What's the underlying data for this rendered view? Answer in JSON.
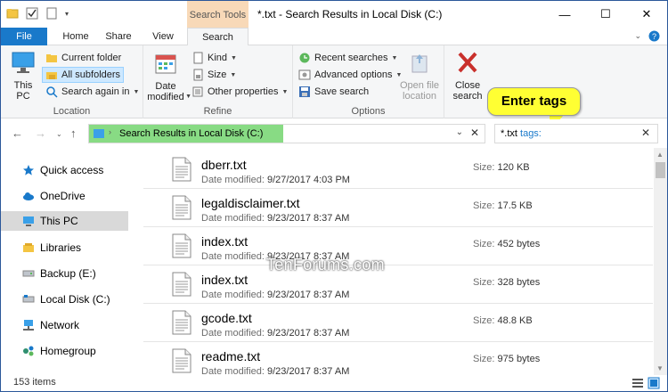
{
  "titlebar": {
    "context_tab": "Search Tools",
    "title": "*.txt - Search Results in Local Disk (C:)",
    "minimize": "—",
    "maximize": "☐",
    "close": "✕"
  },
  "tabs": {
    "file": "File",
    "home": "Home",
    "share": "Share",
    "view": "View",
    "search": "Search"
  },
  "ribbon": {
    "location": {
      "label": "Location",
      "this_pc": "This PC",
      "current_folder": "Current folder",
      "all_subfolders": "All subfolders",
      "search_again_in": "Search again in"
    },
    "refine": {
      "label": "Refine",
      "date_modified": "Date modified",
      "kind": "Kind",
      "size": "Size",
      "other_properties": "Other properties"
    },
    "options": {
      "label": "Options",
      "recent_searches": "Recent searches",
      "advanced_options": "Advanced options",
      "save_search": "Save search",
      "open_file_location": "Open file location"
    },
    "close": {
      "close_search": "Close search"
    }
  },
  "address": {
    "path": "Search Results in Local Disk (C:)"
  },
  "search": {
    "query": "*.txt",
    "tags_keyword": "tags:"
  },
  "callout": {
    "text": "Enter tags"
  },
  "nav": {
    "items": [
      {
        "label": "Quick access",
        "icon": "star-icon"
      },
      {
        "label": "OneDrive",
        "icon": "cloud-icon"
      },
      {
        "label": "This PC",
        "icon": "computer-icon"
      },
      {
        "label": "Libraries",
        "icon": "library-icon"
      },
      {
        "label": "Backup (E:)",
        "icon": "drive-icon"
      },
      {
        "label": "Local Disk (C:)",
        "icon": "drive-icon"
      },
      {
        "label": "Network",
        "icon": "network-icon"
      },
      {
        "label": "Homegroup",
        "icon": "homegroup-icon"
      }
    ]
  },
  "files": {
    "date_label": "Date modified:",
    "size_label": "Size:",
    "items": [
      {
        "name": "dberr.txt",
        "date": "9/27/2017 4:03 PM",
        "size": "120 KB"
      },
      {
        "name": "legaldisclaimer.txt",
        "date": "9/23/2017 8:37 AM",
        "size": "17.5 KB"
      },
      {
        "name": "index.txt",
        "date": "9/23/2017 8:37 AM",
        "size": "452 bytes"
      },
      {
        "name": "index.txt",
        "date": "9/23/2017 8:37 AM",
        "size": "328 bytes"
      },
      {
        "name": "gcode.txt",
        "date": "9/23/2017 8:37 AM",
        "size": "48.8 KB"
      },
      {
        "name": "readme.txt",
        "date": "9/23/2017 8:37 AM",
        "size": "975 bytes"
      }
    ]
  },
  "watermark": "TenForums.com",
  "status": {
    "count": "153 items"
  },
  "colors": {
    "file_tab": "#1979ca",
    "context_tab": "#f8d9b8",
    "address_highlight": "#88db84",
    "callout": "#ffff33"
  }
}
